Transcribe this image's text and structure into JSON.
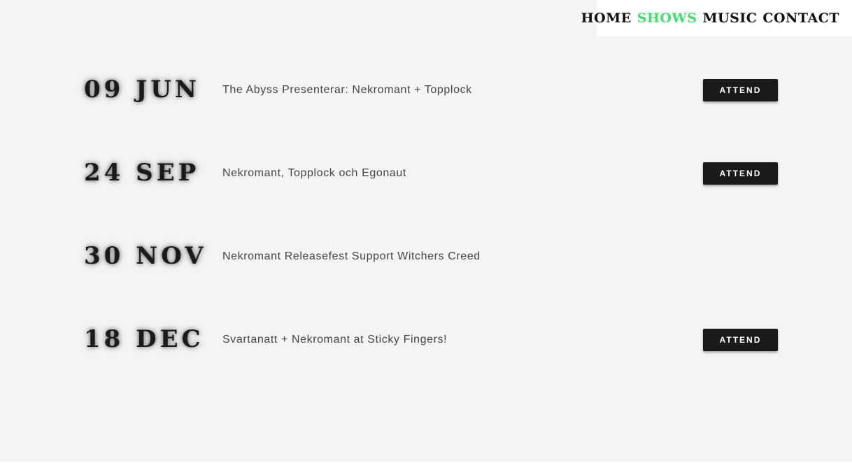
{
  "nav": {
    "items": [
      {
        "label": "HOME",
        "active": false
      },
      {
        "label": "SHOWS",
        "active": true
      },
      {
        "label": "MUSIC",
        "active": false
      },
      {
        "label": "CONTACT",
        "active": false
      }
    ],
    "active_color": "#3fe06b"
  },
  "shows": [
    {
      "date": "09 JUN",
      "title": "The Abyss Presenterar: Nekromant + Topplock",
      "button": "ATTEND"
    },
    {
      "date": "24 SEP",
      "title": "Nekromant, Topplock och Egonaut",
      "button": "ATTEND"
    },
    {
      "date": "30 NOV",
      "title": "Nekromant Releasefest Support Witchers Creed",
      "button": null
    },
    {
      "date": "18 DEC",
      "title": "Svartanatt + Nekromant at Sticky Fingers!",
      "button": "ATTEND"
    }
  ]
}
